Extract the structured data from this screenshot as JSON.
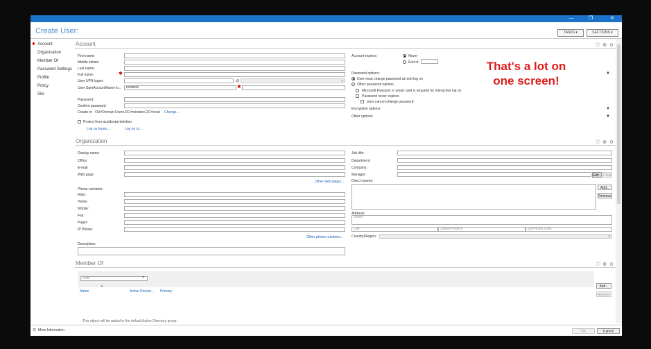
{
  "window": {
    "minimize": "—",
    "maximize": "❐",
    "close": "✕"
  },
  "app": {
    "title": "Create User:",
    "tasks_label": "TASKS",
    "sections_label": "SECTIONS"
  },
  "nav": [
    "Account",
    "Organization",
    "Member Of",
    "Password Settings",
    "Profile",
    "Policy",
    "Silo"
  ],
  "account": {
    "title": "Account",
    "first_name": "First name:",
    "middle_initials": "Middle initials:",
    "last_name": "Last name:",
    "full_name": "Full name:",
    "upn_logon": "User UPN logon:",
    "at": "@",
    "sam_label": "User SamAccountName lo...",
    "sam_value": "reinders",
    "password": "Password:",
    "confirm_password": "Confirm password:",
    "create_in": "Create in:",
    "create_in_value": "OU=Domain Users,DC=reinders,DC=local",
    "change_link": "Change...",
    "protect": "Protect from accidental deletion",
    "logon_hours": "Log on hours...",
    "logon_to": "Log on to...",
    "account_expires": "Account expires:",
    "never": "Never",
    "end_of": "End of",
    "password_options": "Password options:",
    "opt_must_change": "User must change password at next log on",
    "opt_other": "Other password options",
    "opt_passport": "Microsoft Passport or smart card is required for interactive log on",
    "opt_never_expires": "Password never expires",
    "opt_cannot_change": "User cannot change password",
    "encryption_options": "Encryption options:",
    "other_options": "Other options:"
  },
  "annotation": "That's a lot on\none screen!",
  "organization": {
    "title": "Organization",
    "display_name": "Display name:",
    "office": "Office:",
    "email": "E-mail:",
    "web_page": "Web page:",
    "other_web_pages": "Other web pages...",
    "phone_numbers": "Phone numbers:",
    "main": "Main:",
    "home": "Home:",
    "mobile": "Mobile:",
    "fax": "Fax:",
    "pager": "Pager:",
    "ip_phone": "IP Phone:",
    "other_phone_numbers": "Other phone numbers...",
    "description": "Description:",
    "job_title": "Job title:",
    "department": "Department:",
    "company": "Company:",
    "manager": "Manager:",
    "edit": "Edit...",
    "clear": "Clear",
    "direct_reports": "Direct reports:",
    "add": "Add...",
    "remove": "Remove",
    "address": "Address:",
    "street_ph": "Street",
    "city_ph": "City",
    "state_ph": "State/Province",
    "zip_ph": "Zip/Postal code",
    "country": "Country/Region:"
  },
  "member_of": {
    "title": "Member Of",
    "filter_ph": "Filter",
    "col_name": "Name",
    "col_ad": "Active Directo...",
    "col_primary": "Primary",
    "add": "Add...",
    "remove": "Remove",
    "note": "This object will be added to the default Active Directory group."
  },
  "footer": {
    "more_info": "More Information",
    "ok": "OK",
    "cancel": "Cancel"
  }
}
